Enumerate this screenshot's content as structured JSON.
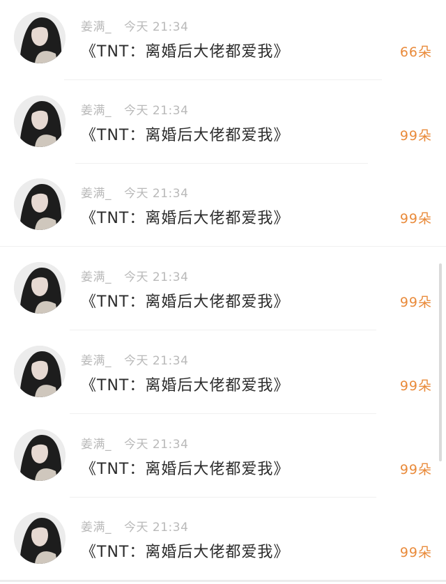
{
  "messages": [
    {
      "sender": "姜满_",
      "time": "今天 21:34",
      "title": "《TNT：离婚后大佬都爱我》",
      "count": "66朵"
    },
    {
      "sender": "姜满_",
      "time": "今天 21:34",
      "title": "《TNT：离婚后大佬都爱我》",
      "count": "99朵"
    },
    {
      "sender": "姜满_",
      "time": "今天 21:34",
      "title": "《TNT：离婚后大佬都爱我》",
      "count": "99朵"
    },
    {
      "sender": "姜满_",
      "time": "今天 21:34",
      "title": "《TNT：离婚后大佬都爱我》",
      "count": "99朵"
    },
    {
      "sender": "姜满_",
      "time": "今天 21:34",
      "title": "《TNT：离婚后大佬都爱我》",
      "count": "99朵"
    },
    {
      "sender": "姜满_",
      "time": "今天 21:34",
      "title": "《TNT：离婚后大佬都爱我》",
      "count": "99朵"
    },
    {
      "sender": "姜满_",
      "time": "今天 21:34",
      "title": "《TNT：离婚后大佬都爱我》",
      "count": "99朵"
    }
  ],
  "colors": {
    "count_accent": "#e98a3a",
    "meta_text": "#b9b9b9",
    "title_text": "#2c2c2c"
  },
  "icons": {
    "avatar": "profile-photo-avatar"
  }
}
